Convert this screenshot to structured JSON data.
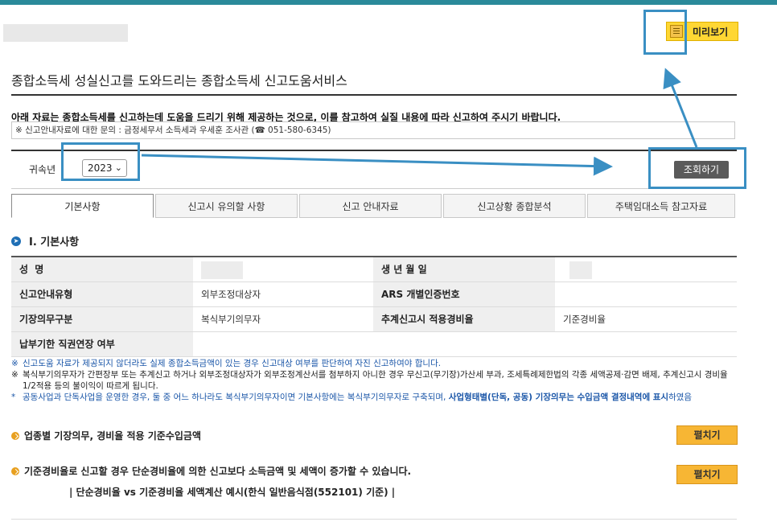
{
  "header": {
    "preview_label": "미리보기",
    "preview_icon": "document-icon"
  },
  "page": {
    "title": "종합소득세 성실신고를 도와드리는 종합소득세 신고도움서비스",
    "notice": "아래 자료는 종합소득세를 신고하는데 도움을 드리기 위해 제공하는 것으로, 이를 참고하여 실질 내용에 따라 신고하여 주시기 바랍니다.",
    "inquiry": "※ 신고안내자료에 대한 문의 : 금정세무서 소득세과 우세훈 조사관 (☎ 051-580-6345)"
  },
  "filter": {
    "year_label": "귀속년",
    "year_value": "2023",
    "search_label": "조회하기"
  },
  "tabs": [
    {
      "label": "기본사항",
      "active": true
    },
    {
      "label": "신고시 유의할 사항",
      "active": false
    },
    {
      "label": "신고 안내자료",
      "active": false
    },
    {
      "label": "신고상황 종합분석",
      "active": false
    },
    {
      "label": "주택임대소득 참고자료",
      "active": false
    }
  ],
  "section": {
    "title": "Ⅰ. 기본사항"
  },
  "info": {
    "name_label": "성 명",
    "dob_label": "생 년 월 일",
    "guide_type_label": "신고안내유형",
    "guide_type_value": "외부조정대상자",
    "ars_label": "ARS 개별인증번호",
    "bookkeeping_label": "기장의무구분",
    "bookkeeping_value": "복식부기의무자",
    "rate_label": "추계신고시 적용경비율",
    "rate_value": "기준경비율",
    "extension_label": "납부기한 직권연장 여부"
  },
  "notes": {
    "n1_mark": "※",
    "n1": "신고도움 자료가 제공되지 않더라도 실제 종합소득금액이 있는 경우 신고대상 여부를 판단하여 자진 신고하여야 합니다.",
    "n2_mark": "※",
    "n2": "복식부기의무자가 간편장부 또는 추계신고 하거나 외부조정대상자가 외부조정계산서를 첨부하지 아니한 경우 무신고(무기장)가산세 부과, 조세특례제한법의 각종 세액공제·감면 배제, 추계신고시 경비율 1/2적용 등의 불이익이 따르게 됩니다.",
    "n3_mark": "*",
    "n3_a": "공동사업과 단독사업을 운영한 경우, 둘 중 어느 하나라도 복식부기의무자이면 기본사항에는 복식부기의무자로 구축되며, ",
    "n3_b": "사업형태별(단독, 공동) 기장의무는 수입금액 결정내역에 표시",
    "n3_c": "하였음"
  },
  "subsections": {
    "s1": "업종별 기장의무, 경비율 적용 기준수입금액",
    "s1_button": "펼치기",
    "s2": "기준경비율로 신고할 경우 단순경비율에 의한 신고보다 소득금액 및 세액이 증가할 수 있습니다.",
    "s2_button": "펼치기",
    "example": "| 단순경비율 vs 기준경비율 세액계산 예시(한식 일반음식점(552101) 기준) |"
  },
  "colors": {
    "accent": "#3a8fc3",
    "button_yellow": "#ffd733",
    "button_orange": "#f7b634"
  }
}
